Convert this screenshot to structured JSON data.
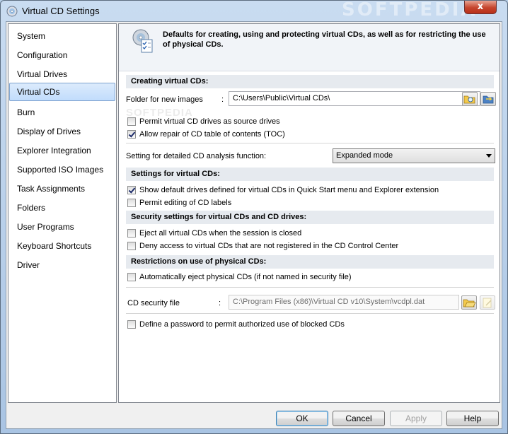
{
  "window": {
    "title": "Virtual CD Settings",
    "watermark": "SOFTPEDIA",
    "close_glyph": "x"
  },
  "sidebar": {
    "items": [
      {
        "label": "System"
      },
      {
        "label": "Configuration"
      },
      {
        "label": "Virtual Drives"
      },
      {
        "label": "Virtual CDs"
      },
      {
        "label": "Burn"
      },
      {
        "label": "Display of Drives"
      },
      {
        "label": "Explorer Integration"
      },
      {
        "label": "Supported ISO Images"
      },
      {
        "label": "Task Assignments"
      },
      {
        "label": "Folders"
      },
      {
        "label": "User Programs"
      },
      {
        "label": "Keyboard Shortcuts"
      },
      {
        "label": "Driver"
      }
    ],
    "selected_index": 3
  },
  "header": {
    "text": "Defaults for creating, using and protecting virtual CDs, as well as for restricting the use of physical CDs.",
    "icon": "cd-settings-icon"
  },
  "content": {
    "watermark": "SOFTPEDIA",
    "creating": {
      "title": "Creating virtual CDs:",
      "folder_label": "Folder for new images",
      "colon": ":",
      "folder_value": "C:\\Users\\Public\\Virtual CDs\\",
      "permit_source": {
        "label": "Permit virtual CD drives as source drives",
        "checked": false
      },
      "allow_repair": {
        "label": "Allow repair of CD table of contents (TOC)",
        "checked": true
      },
      "analysis_label": "Setting for detailed CD analysis function:",
      "analysis_value": "Expanded mode"
    },
    "settings": {
      "title": "Settings for virtual CDs:",
      "show_default": {
        "label": "Show default drives defined for virtual CDs in Quick Start menu and Explorer extension",
        "checked": true
      },
      "permit_editing": {
        "label": "Permit editing of CD labels",
        "checked": false
      }
    },
    "security": {
      "title": "Security settings for virtual CDs and CD drives:",
      "eject_all": {
        "label": "Eject all virtual CDs when the session is closed",
        "checked": false
      },
      "deny_access": {
        "label": "Deny access to virtual CDs that are not registered in the CD Control Center",
        "checked": false
      }
    },
    "restrictions": {
      "title": "Restrictions on use of physical CDs:",
      "auto_eject": {
        "label": "Automatically eject physical CDs (if not named in security file)",
        "checked": false
      },
      "security_file_label": "CD security file",
      "colon": ":",
      "security_file_value": "C:\\Program Files (x86)\\Virtual CD v10\\System\\vcdpl.dat",
      "define_password": {
        "label": "Define a password to permit authorized use of blocked CDs",
        "checked": false
      }
    }
  },
  "buttons": {
    "ok": "OK",
    "cancel": "Cancel",
    "apply": "Apply",
    "help": "Help"
  },
  "colors": {
    "accent": "#3c7fb1",
    "section_bg": "#e6eaef",
    "selected_bg": "#c1dcfc"
  }
}
